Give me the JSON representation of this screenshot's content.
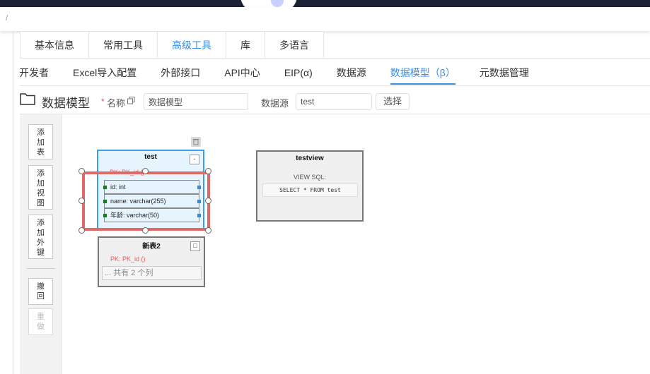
{
  "breadcrumb": "/",
  "tabs_primary": [
    {
      "label": "基本信息",
      "active": false
    },
    {
      "label": "常用工具",
      "active": false
    },
    {
      "label": "高级工具",
      "active": true
    },
    {
      "label": "库",
      "active": false
    },
    {
      "label": "多语言",
      "active": false
    }
  ],
  "tabs_secondary": [
    {
      "label": "开发者",
      "active": false
    },
    {
      "label": "Excel导入配置",
      "active": false
    },
    {
      "label": "外部接口",
      "active": false
    },
    {
      "label": "API中心",
      "active": false
    },
    {
      "label": "EIP(α)",
      "active": false
    },
    {
      "label": "数据源",
      "active": false
    },
    {
      "label": "数据模型（β）",
      "active": true
    },
    {
      "label": "元数据管理",
      "active": false
    }
  ],
  "page": {
    "title": "数据模型",
    "required_mark": "*",
    "name_label": "名称",
    "name_value": "数据模型",
    "datasource_label": "数据源",
    "datasource_value": "test",
    "select_button": "选择"
  },
  "toolbar": {
    "add_table": "添\n加\n表",
    "add_view": "添\n加\n视\n图",
    "add_fk": "添\n加\n外\n键",
    "undo": "撤\n回",
    "redo": "重\n做"
  },
  "model": {
    "table_test": {
      "name": "test",
      "pk": "PK: PK_id ()",
      "collapse": "-",
      "columns": [
        "id: int",
        "name: varchar(255)",
        "年龄: varchar(50)"
      ]
    },
    "table_new2": {
      "name": "新表2",
      "pk": "PK: PK_id ()",
      "expand": "□",
      "count": "... 共有 2 个列"
    },
    "view_testview": {
      "name": "testview",
      "sql_label": "VIEW SQL:",
      "sql": "SELECT * FROM test"
    }
  },
  "colors": {
    "accent": "#3a8ee6",
    "selection": "#e06a6a",
    "pk": "#ee5555"
  }
}
